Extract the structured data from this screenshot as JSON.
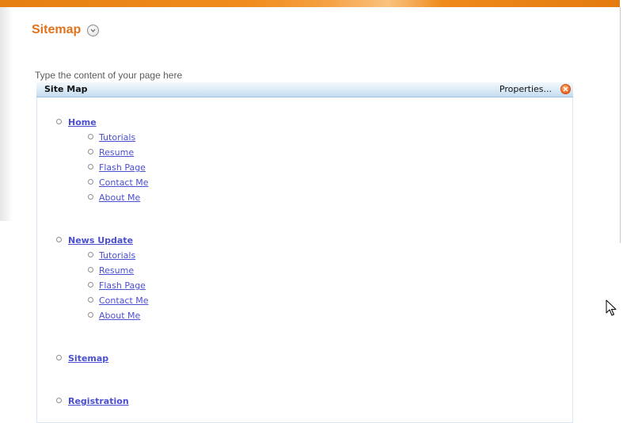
{
  "header": {
    "title": "Sitemap",
    "toggle_icon": "chevron-down-circle-icon",
    "accent_color": "#e2731a"
  },
  "content": {
    "hint": "Type the content of your page here"
  },
  "panel": {
    "title": "Site Map",
    "properties_label": "Properties...",
    "close_icon": "close-circle-icon"
  },
  "sitemap": {
    "link_color": "#4a4fd0",
    "groups": [
      {
        "label": "Home",
        "children": [
          "Tutorials",
          "Resume",
          "Flash Page",
          "Contact Me",
          "About Me"
        ]
      },
      {
        "label": "News Update",
        "children": [
          "Tutorials",
          "Resume",
          "Flash Page",
          "Contact Me",
          "About Me"
        ]
      },
      {
        "label": "Sitemap",
        "children": []
      },
      {
        "label": "Registration",
        "children": []
      }
    ]
  },
  "icons": {
    "bullet": "circle-bullet-icon",
    "pointer": "mouse-pointer-icon"
  }
}
